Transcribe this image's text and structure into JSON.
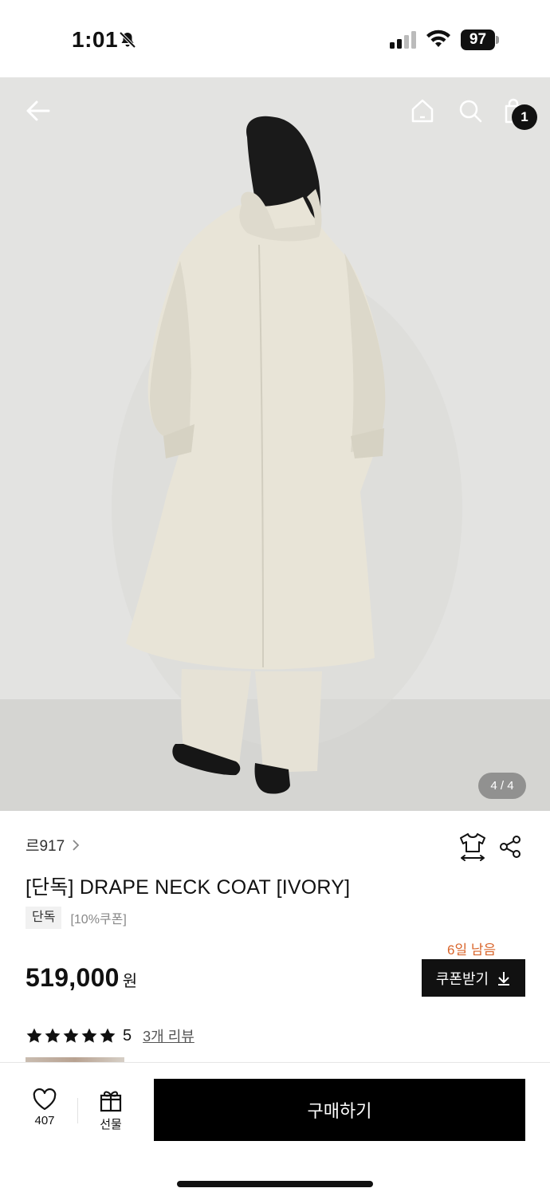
{
  "status_bar": {
    "time": "1:01",
    "battery": "97",
    "icons": [
      "bell-slash-icon",
      "signal-icon",
      "wifi-icon",
      "battery-icon"
    ]
  },
  "hero": {
    "page_indicator": "4 / 4",
    "cart_count": "1",
    "icons": [
      "back-arrow-icon",
      "home-icon",
      "search-icon",
      "shopping-bag-icon"
    ]
  },
  "product": {
    "brand": "르917",
    "title": "[단독] DRAPE NECK COAT [IVORY]",
    "tag": "단독",
    "tag_extra": "[10%쿠폰]",
    "days_left": "6일 남음",
    "price": "519,000",
    "price_unit": "원",
    "coupon_label": "쿠폰받기",
    "rating": "5",
    "rating_stars": 5,
    "review_link": "3개 리뷰"
  },
  "bottom_bar": {
    "wish_count": "407",
    "gift_label": "선물",
    "buy_label": "구매하기"
  },
  "colors": {
    "accent_orange": "#d9652b",
    "primary_black": "#000000",
    "coat_ivory": "#e9e5d9"
  }
}
